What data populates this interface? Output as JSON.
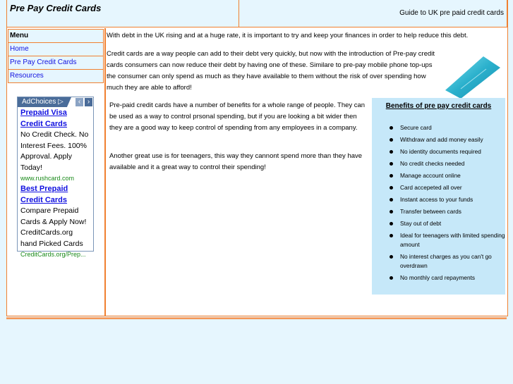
{
  "header": {
    "site_title": "Pre Pay Credit Cards",
    "tagline": "Guide to UK pre paid credit cards"
  },
  "menu": {
    "heading": "Menu",
    "items": [
      {
        "label": "Home"
      },
      {
        "label": "Pre Pay Credit Cards"
      },
      {
        "label": "Resources"
      }
    ]
  },
  "ad": {
    "adchoices_label": "AdChoices",
    "prev_icon": "‹",
    "next_icon": "›",
    "ads": [
      {
        "title": "Prepaid Visa Credit Cards",
        "text": "No Credit Check. No Interest Fees. 100% Approval. Apply Today!",
        "url": "www.rushcard.com"
      },
      {
        "title": "Best Prepaid Credit Cards",
        "text": "Compare Prepaid Cards & Apply Now! CreditCards.org hand Picked Cards",
        "url": "CreditCards.org/Prep..."
      }
    ]
  },
  "content": {
    "intro": "With debt in the UK rising and at a huge rate, it is important to try and keep your finances in order to help reduce this debt.",
    "para2": "Credit cards are a way people can add to their debt very quickly, but now with the introduction of Pre-pay credit cards consumers can now reduce their debt by having one of these. Similare to pre-pay mobile phone top-ups the consumer can only spend as much as they have available to them without the risk of over spending how much they are able to afford!",
    "para3": "Pre-paid credit cards have a number of benefits for a whole range of people. They can be used as a way to control prsonal spending, but if you are looking a bit wider then they are a good way to keep control of spending from any employees in a company.",
    "para4": "Another great use is for teenagers, this way they cannont spend more than they have available and it a great way to control their spending!"
  },
  "benefits": {
    "title": "Benefits of pre pay credit cards",
    "items": [
      "Secure card",
      "Withdraw and add money easily",
      "No identity documents required",
      "No credit checks needed",
      "Manage account online",
      "Card accepeted all over",
      "Instant access to your funds",
      "Transfer between cards",
      "Stay out of debt",
      "Ideal for teenagers with limited spending amount",
      "No interest charges as you can't go overdrawn",
      "No monthly card repayments"
    ]
  },
  "colors": {
    "border": "#f08030",
    "background": "#e6f6fe",
    "benefits_bg": "#c6e8f9",
    "link": "#1010e0",
    "ad_url": "#1a8a1a"
  }
}
